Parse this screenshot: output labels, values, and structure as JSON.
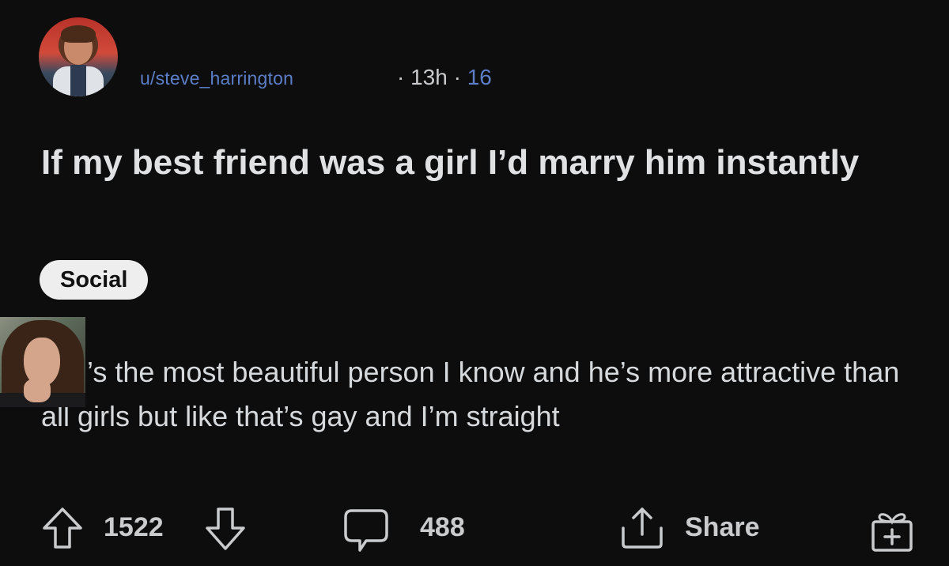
{
  "post": {
    "username": "u/steve_harrington",
    "sep1": "·",
    "age": "13h",
    "sep2": "·",
    "extra_count": "16",
    "title": "If my best friend was a girl I’d marry him instantly",
    "flair": "Social",
    "body": "’s the most beautiful person I know and he’s more attractive than all girls but like that’s gay and I’m straight"
  },
  "actions": {
    "score": "1522",
    "comments": "488",
    "share_label": "Share"
  },
  "icons": {
    "upvote": "arrow-up-icon",
    "downvote": "arrow-down-icon",
    "comment": "comment-bubble-icon",
    "share": "share-icon",
    "award": "gift-icon"
  },
  "colors": {
    "background": "#0d0d0e",
    "username": "#5b7ec7",
    "flair_bg": "#eeeeee"
  }
}
